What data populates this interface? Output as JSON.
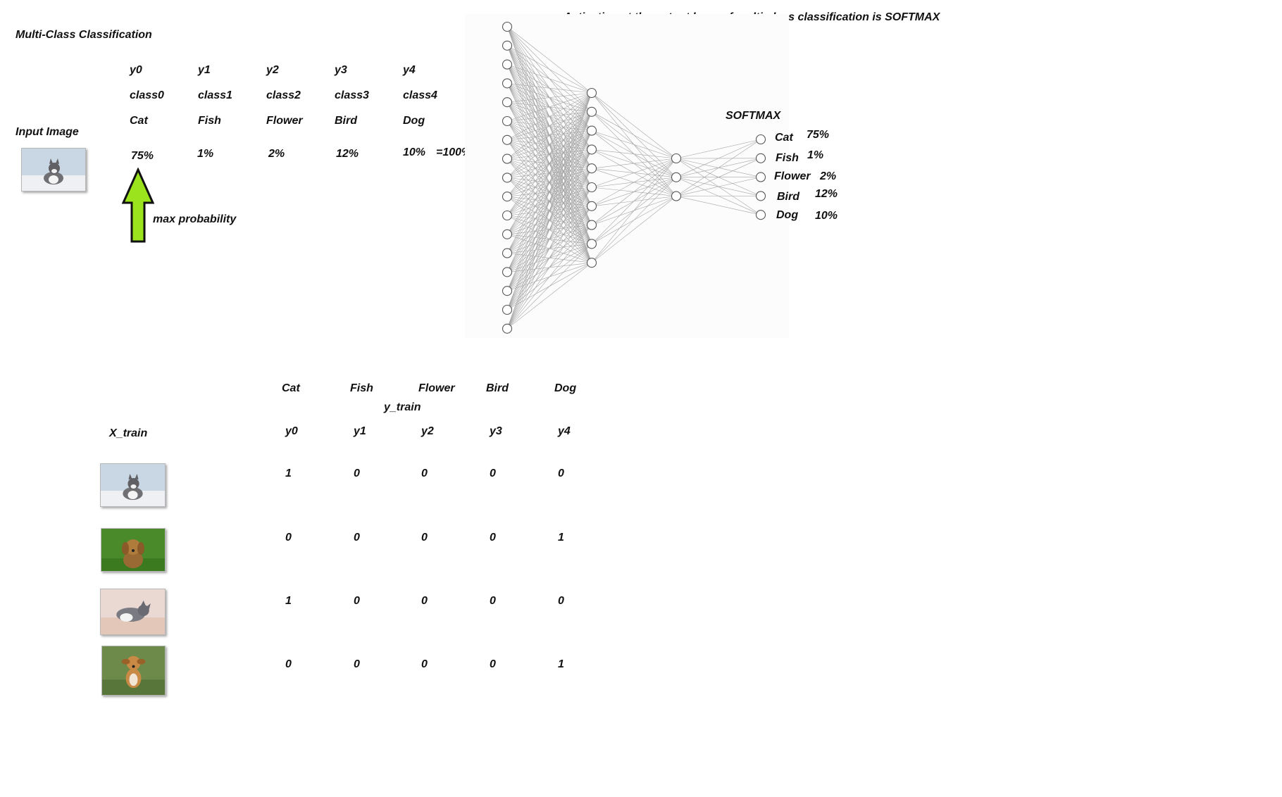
{
  "title": "Multi-Class Classification",
  "input_label": "Input Image",
  "top_table": {
    "y_labels": [
      "y0",
      "y1",
      "y2",
      "y3",
      "y4"
    ],
    "class_labels": [
      "class0",
      "class1",
      "class2",
      "class3",
      "class4"
    ],
    "names": [
      "Cat",
      "Fish",
      "Flower",
      "Bird",
      "Dog"
    ],
    "probs": [
      "75%",
      "1%",
      "2%",
      "12%",
      "10%"
    ],
    "sum": "=100%"
  },
  "max_label": "max probability",
  "network": {
    "caption": "Activation at the output layer of multi-class classification is SOFTMAX",
    "softmax_label": "SOFTMAX",
    "layers": [
      17,
      10,
      3,
      5
    ],
    "outputs": [
      {
        "name": "Cat",
        "value": "75%"
      },
      {
        "name": "Fish",
        "value": "1%"
      },
      {
        "name": "Flower",
        "value": "2%"
      },
      {
        "name": "Bird",
        "value": "12%"
      },
      {
        "name": "Dog",
        "value": "10%"
      }
    ]
  },
  "train": {
    "x_label": "X_train",
    "y_label": "y_train",
    "class_names": [
      "Cat",
      "Fish",
      "Flower",
      "Bird",
      "Dog"
    ],
    "y_labels": [
      "y0",
      "y1",
      "y2",
      "y3",
      "y4"
    ],
    "rows": [
      {
        "image": "cat-photo",
        "values": [
          "1",
          "0",
          "0",
          "0",
          "0"
        ]
      },
      {
        "image": "dog-photo",
        "values": [
          "0",
          "0",
          "0",
          "0",
          "1"
        ]
      },
      {
        "image": "cat-photo",
        "values": [
          "1",
          "0",
          "0",
          "0",
          "0"
        ]
      },
      {
        "image": "dog-photo",
        "values": [
          "0",
          "0",
          "0",
          "0",
          "1"
        ]
      }
    ]
  }
}
